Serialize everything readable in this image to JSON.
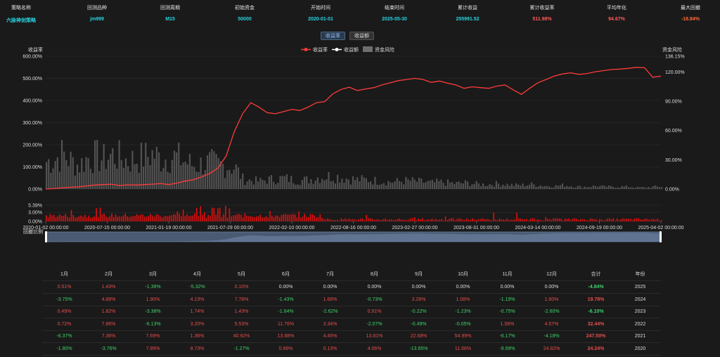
{
  "header": {
    "fields": [
      {
        "label": "策略名称",
        "value": "六脉神剑策略",
        "color": "#27d3e0"
      },
      {
        "label": "回测品种",
        "value": "jm999",
        "color": "#27d3e0"
      },
      {
        "label": "回测周期",
        "value": "M15",
        "color": "#27d3e0"
      },
      {
        "label": "初始资金",
        "value": "50000",
        "color": "#27d3e0"
      },
      {
        "label": "开始时间",
        "value": "2020-01-01",
        "color": "#27d3e0"
      },
      {
        "label": "结束时间",
        "value": "2025-05-30",
        "color": "#27d3e0"
      },
      {
        "label": "累计收益",
        "value": "255991.52",
        "color": "#27d3e0"
      },
      {
        "label": "累计收益率",
        "value": "511.98%",
        "color": "#ff5a5a"
      },
      {
        "label": "平均年化",
        "value": "94.67%",
        "color": "#ff5a5a"
      },
      {
        "label": "最大回撤",
        "value": "-18.84%",
        "color": "#ff6a3a"
      }
    ]
  },
  "tabs": {
    "rate": "收益率",
    "amount": "收益额"
  },
  "chart_data": {
    "type": "line",
    "legend": [
      "收益率",
      "收益额",
      "资金风险"
    ],
    "legend_placement": "top-center",
    "ylabel_left": "收益率",
    "ylabel_right": "资金风险",
    "y_left_ticks": [
      "600.00%",
      "500.00%",
      "400.00%",
      "300.00%",
      "200.00%",
      "100.00%",
      "0.00%"
    ],
    "y_right_ticks": [
      "136.15%",
      "120.00%",
      "90.00%",
      "60.00%",
      "30.00%",
      "0.00%"
    ],
    "ylim_left": [
      0,
      600
    ],
    "ylim_right": [
      0,
      136.15
    ],
    "lower_ticks": [
      "5.39%",
      "3.00%",
      "0.00%"
    ],
    "x_ticks": [
      "2020-01-02 00:00:00",
      "2020-07-15 00:00:00",
      "2021-01-19 00:00:00",
      "2021-07-29 00:00:00",
      "2022-02-10 00:00:00",
      "2022-08-16 00:00:00",
      "2023-02-27 00:00:00",
      "2023-08-31 00:00:00",
      "2024-03-14 00:00:00",
      "2024-09-19 00:00:00",
      "2025-04-02 00:00:00"
    ],
    "series": [
      {
        "name": "收益率",
        "color": "#ff3b3b",
        "values": [
          0,
          2,
          5,
          8,
          10,
          14,
          18,
          20,
          22,
          16,
          19,
          18,
          20,
          22,
          25,
          20,
          27,
          36,
          42,
          55,
          70,
          95,
          150,
          260,
          340,
          390,
          370,
          345,
          340,
          350,
          360,
          355,
          370,
          390,
          395,
          430,
          450,
          460,
          445,
          452,
          458,
          470,
          480,
          490,
          495,
          500,
          495,
          482,
          488,
          478,
          470,
          455,
          462,
          458,
          455,
          465,
          470,
          448,
          428,
          455,
          480,
          495,
          510,
          520,
          525,
          518,
          522,
          530,
          535,
          540,
          542,
          545,
          550,
          548,
          505,
          510
        ]
      },
      {
        "name": "资金风险",
        "color": "#6e6e6e",
        "values": [
          35,
          38,
          45,
          36,
          30,
          40,
          42,
          38,
          44,
          40,
          36,
          39,
          41,
          45,
          38,
          42,
          40,
          35,
          30,
          32,
          34,
          31,
          30,
          28,
          12,
          11,
          10,
          12,
          13,
          14,
          12,
          11,
          12,
          15,
          16,
          17,
          15,
          13,
          12,
          12,
          11,
          10,
          9,
          10,
          11,
          10,
          9,
          8,
          9,
          8,
          7,
          8,
          7,
          6,
          6,
          7,
          6,
          5,
          5,
          6,
          5,
          4,
          4,
          5,
          4,
          3,
          3,
          4,
          3,
          3,
          3,
          3,
          2,
          2,
          3,
          3
        ]
      }
    ],
    "range_slider_label": "回撤比例"
  },
  "table": {
    "headers": [
      "1月",
      "2月",
      "3月",
      "4月",
      "5月",
      "6月",
      "7月",
      "8月",
      "9月",
      "10月",
      "11月",
      "12月",
      "合计",
      "年份"
    ],
    "rows": [
      {
        "year": "2025",
        "total": "-4.84%",
        "cells": [
          "0.51%",
          "1.43%",
          "-1.39%",
          "-5.32%",
          "0.10%",
          "0.00%",
          "0.00%",
          "0.00%",
          "0.00%",
          "0.00%",
          "0.00%",
          "0.00%"
        ]
      },
      {
        "year": "2024",
        "total": "19.78%",
        "cells": [
          "-3.75%",
          "4.88%",
          "1.90%",
          "4.13%",
          "7.78%",
          "-1.43%",
          "1.68%",
          "-0.73%",
          "3.28%",
          "1.08%",
          "-1.19%",
          "1.60%"
        ]
      },
      {
        "year": "2023",
        "total": "-6.10%",
        "cells": [
          "0.49%",
          "1.82%",
          "-3.38%",
          "1.74%",
          "1.43%",
          "-1.64%",
          "-2.62%",
          "0.91%",
          "-0.22%",
          "-1.23%",
          "-0.75%",
          "-2.60%"
        ]
      },
      {
        "year": "2022",
        "total": "32.44%",
        "cells": [
          "0.72%",
          "7.86%",
          "-6.13%",
          "3.20%",
          "5.53%",
          "11.76%",
          "3.34%",
          "-2.07%",
          "-0.49%",
          "-0.05%",
          "1.58%",
          "4.57%"
        ]
      },
      {
        "year": "2021",
        "total": "247.50%",
        "cells": [
          "-6.37%",
          "7.36%",
          "7.69%",
          "1.36%",
          "40.92%",
          "13.88%",
          "4.45%",
          "13.81%",
          "22.68%",
          "54.99%",
          "-6.17%",
          "-4.18%"
        ]
      },
      {
        "year": "2020",
        "total": "24.24%",
        "cells": [
          "-1.80%",
          "-3.76%",
          "7.89%",
          "8.73%",
          "-1.27%",
          "0.66%",
          "0.13%",
          "4.06%",
          "-13.65%",
          "11.66%",
          "-9.69%",
          "24.82%"
        ]
      }
    ]
  }
}
